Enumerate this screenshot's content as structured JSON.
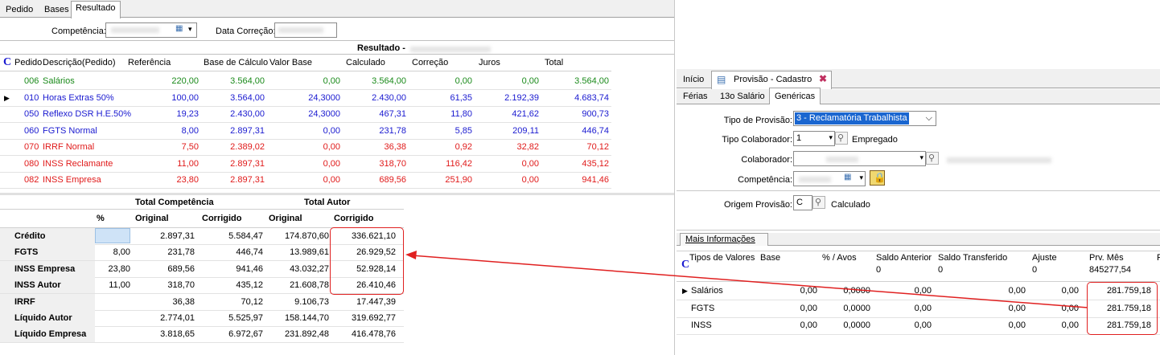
{
  "left": {
    "tabs": [
      {
        "label": "Pedido"
      },
      {
        "label": "Bases"
      },
      {
        "label": "Resultado"
      }
    ],
    "competencia_label": "Competência:",
    "data_correcao_label": "Data Correção:",
    "resultado_title": "Resultado -",
    "grid_icon": "C",
    "columns": [
      "Pedido",
      "Descrição(Pedido)",
      "Referência",
      "Base de Cálculo",
      "Valor Base",
      "Calculado",
      "Correção",
      "Juros",
      "Total"
    ],
    "rows": [
      {
        "pedido": "006",
        "descricao": "Salários",
        "referencia": "220,00",
        "base": "3.564,00",
        "valor_base": "0,00",
        "calculado": "3.564,00",
        "correcao": "0,00",
        "juros": "0,00",
        "total": "3.564,00",
        "color": "#1a8a1a"
      },
      {
        "pedido": "010",
        "descricao": "Horas Extras 50%",
        "referencia": "100,00",
        "base": "3.564,00",
        "valor_base": "24,3000",
        "calculado": "2.430,00",
        "correcao": "61,35",
        "juros": "2.192,39",
        "total": "4.683,74",
        "color": "#1a1ad0"
      },
      {
        "pedido": "050",
        "descricao": "Reflexo DSR H.E.50%",
        "referencia": "19,23",
        "base": "2.430,00",
        "valor_base": "24,3000",
        "calculado": "467,31",
        "correcao": "11,80",
        "juros": "421,62",
        "total": "900,73",
        "color": "#1a1ad0"
      },
      {
        "pedido": "060",
        "descricao": "FGTS Normal",
        "referencia": "8,00",
        "base": "2.897,31",
        "valor_base": "0,00",
        "calculado": "231,78",
        "correcao": "5,85",
        "juros": "209,11",
        "total": "446,74",
        "color": "#1a1ad0"
      },
      {
        "pedido": "070",
        "descricao": "IRRF Normal",
        "referencia": "7,50",
        "base": "2.389,02",
        "valor_base": "0,00",
        "calculado": "36,38",
        "correcao": "0,92",
        "juros": "32,82",
        "total": "70,12",
        "color": "#e01a1a"
      },
      {
        "pedido": "080",
        "descricao": "INSS Reclamante",
        "referencia": "11,00",
        "base": "2.897,31",
        "valor_base": "0,00",
        "calculado": "318,70",
        "correcao": "116,42",
        "juros": "0,00",
        "total": "435,12",
        "color": "#e01a1a"
      },
      {
        "pedido": "082",
        "descricao": "INSS Empresa",
        "referencia": "23,80",
        "base": "2.897,31",
        "valor_base": "0,00",
        "calculado": "689,56",
        "correcao": "251,90",
        "juros": "0,00",
        "total": "941,46",
        "color": "#e01a1a"
      }
    ],
    "summary": {
      "group_competencia": "Total Competência",
      "group_autor": "Total Autor",
      "col_pct": "%",
      "col_original": "Original",
      "col_corrigido": "Corrigido",
      "col_original2": "Original",
      "col_corrigido2": "Corrigido",
      "rows": [
        {
          "label": "Crédito",
          "pct": "",
          "original": "2.897,31",
          "corrigido": "5.584,47",
          "autor_original": "174.870,60",
          "autor_corrigido": "336.621,10"
        },
        {
          "label": "FGTS",
          "pct": "8,00",
          "original": "231,78",
          "corrigido": "446,74",
          "autor_original": "13.989,61",
          "autor_corrigido": "26.929,52"
        },
        {
          "label": "INSS Empresa",
          "pct": "23,80",
          "original": "689,56",
          "corrigido": "941,46",
          "autor_original": "43.032,27",
          "autor_corrigido": "52.928,14"
        },
        {
          "label": "INSS Autor",
          "pct": "11,00",
          "original": "318,70",
          "corrigido": "435,12",
          "autor_original": "21.608,78",
          "autor_corrigido": "26.410,46"
        },
        {
          "label": "IRRF",
          "pct": "",
          "original": "36,38",
          "corrigido": "70,12",
          "autor_original": "9.106,73",
          "autor_corrigido": "17.447,39"
        },
        {
          "label": "Líquido Autor",
          "pct": "",
          "original": "2.774,01",
          "corrigido": "5.525,97",
          "autor_original": "158.144,70",
          "autor_corrigido": "319.692,77"
        },
        {
          "label": "Líquido Empresa",
          "pct": "",
          "original": "3.818,65",
          "corrigido": "6.972,67",
          "autor_original": "231.892,48",
          "autor_corrigido": "416.478,76"
        }
      ]
    }
  },
  "right": {
    "top_tabs": [
      {
        "label": "Início"
      },
      {
        "label": "Provisão - Cadastro"
      }
    ],
    "sub_tabs": [
      {
        "label": "Férias"
      },
      {
        "label": "13o Salário"
      },
      {
        "label": "Genéricas"
      }
    ],
    "tipo_provisao_label": "Tipo de Provisão:",
    "tipo_provisao_value": "3 - Reclamatória Trabalhista",
    "tipo_colaborador_label": "Tipo Colaborador:",
    "tipo_colaborador_value": "1",
    "tipo_colaborador_desc": "Empregado",
    "colaborador_label": "Colaborador:",
    "competencia_label": "Competência:",
    "origem_label": "Origem Provisão:",
    "origem_value": "C",
    "origem_desc": "Calculado",
    "mais_info": "Mais Informações",
    "grid_icon": "C",
    "columns": [
      "Tipos de Valores",
      "Base",
      "% / Avos",
      "Saldo Anterior",
      "Saldo Transferido",
      "Ajuste",
      "Prv. Mês",
      "P"
    ],
    "totals": {
      "saldo_anterior": "0",
      "saldo_transferido": "0",
      "ajuste": "0",
      "prv_mes": "845277,54"
    },
    "rows": [
      {
        "tipo": "Salários",
        "base": "0,00",
        "avos": "0,0000",
        "saldo_anterior": "0,00",
        "saldo_transferido": "0,00",
        "ajuste": "0,00",
        "prv_mes": "281.759,18"
      },
      {
        "tipo": "FGTS",
        "base": "0,00",
        "avos": "0,0000",
        "saldo_anterior": "0,00",
        "saldo_transferido": "0,00",
        "ajuste": "0,00",
        "prv_mes": "281.759,18"
      },
      {
        "tipo": "INSS",
        "base": "0,00",
        "avos": "0,0000",
        "saldo_anterior": "0,00",
        "saldo_transferido": "0,00",
        "ajuste": "0,00",
        "prv_mes": "281.759,18"
      }
    ]
  }
}
